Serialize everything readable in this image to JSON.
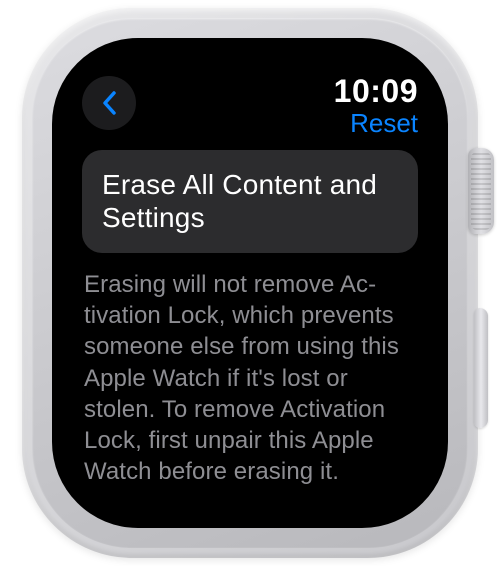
{
  "header": {
    "time": "10:09",
    "title": "Reset"
  },
  "main": {
    "erase_button_label": "Erase All Content and Settings",
    "description": "Erasing will not remove Ac­tivation Lock, which pre­vents someone else from using this Apple Watch if it's lost or stolen. To re­move Activation Lock, first unpair this Apple Watch be­fore erasing it."
  },
  "colors": {
    "accent": "#0a84ff",
    "card": "#2c2c2e",
    "muted": "#8e8e93"
  }
}
